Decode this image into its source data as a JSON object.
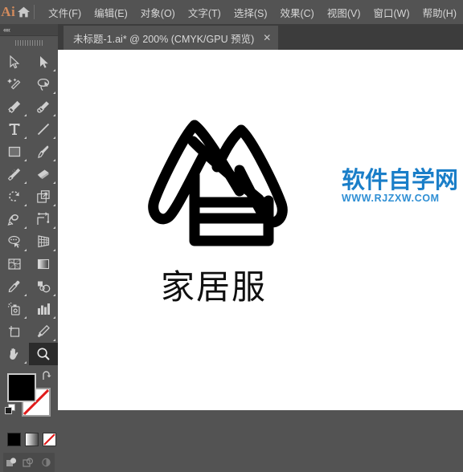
{
  "app": {
    "name": "Adobe Illustrator",
    "logo_text": "Ai",
    "logo_color": "#d38b5d",
    "chrome_bg": "#535353"
  },
  "menubar": {
    "home_icon": "home-icon",
    "items": [
      {
        "label": "文件(F)"
      },
      {
        "label": "编辑(E)"
      },
      {
        "label": "对象(O)"
      },
      {
        "label": "文字(T)"
      },
      {
        "label": "选择(S)"
      },
      {
        "label": "效果(C)"
      },
      {
        "label": "视图(V)"
      },
      {
        "label": "窗口(W)"
      },
      {
        "label": "帮助(H)"
      }
    ]
  },
  "tabbar": {
    "active_tab": "未标题-1.ai* @ 200% (CMYK/GPU 预览)",
    "close_label": "✕"
  },
  "toolbar": {
    "collapse_label": "««",
    "tools": [
      {
        "name": "selection-tool",
        "title": "选择工具",
        "has_flyout": false,
        "active": false
      },
      {
        "name": "direct-selection-tool",
        "title": "直接选择工具",
        "has_flyout": true,
        "active": false
      },
      {
        "name": "magic-wand-tool",
        "title": "魔棒工具",
        "has_flyout": false,
        "active": false
      },
      {
        "name": "lasso-tool",
        "title": "套索工具",
        "has_flyout": true,
        "active": false
      },
      {
        "name": "pen-tool",
        "title": "钢笔工具",
        "has_flyout": true,
        "active": false
      },
      {
        "name": "curvature-tool",
        "title": "曲率工具",
        "has_flyout": true,
        "active": false
      },
      {
        "name": "type-tool",
        "title": "文字工具",
        "has_flyout": true,
        "active": false
      },
      {
        "name": "line-segment-tool",
        "title": "直线段工具",
        "has_flyout": true,
        "active": false
      },
      {
        "name": "rectangle-tool",
        "title": "矩形工具",
        "has_flyout": true,
        "active": false
      },
      {
        "name": "paintbrush-tool",
        "title": "画笔工具",
        "has_flyout": true,
        "active": false
      },
      {
        "name": "shaper-tool",
        "title": "Shaper 工具",
        "has_flyout": true,
        "active": false
      },
      {
        "name": "eraser-tool",
        "title": "橡皮擦工具",
        "has_flyout": true,
        "active": false
      },
      {
        "name": "rotate-tool",
        "title": "旋转工具",
        "has_flyout": true,
        "active": false
      },
      {
        "name": "scale-tool",
        "title": "比例缩放工具",
        "has_flyout": true,
        "active": false
      },
      {
        "name": "width-tool",
        "title": "宽度工具",
        "has_flyout": true,
        "active": false
      },
      {
        "name": "free-transform-tool",
        "title": "自由变换工具",
        "has_flyout": true,
        "active": false
      },
      {
        "name": "shape-builder-tool",
        "title": "形状生成器工具",
        "has_flyout": true,
        "active": false
      },
      {
        "name": "perspective-grid-tool",
        "title": "透视网格工具",
        "has_flyout": true,
        "active": false
      },
      {
        "name": "mesh-tool",
        "title": "网格工具",
        "has_flyout": false,
        "active": false
      },
      {
        "name": "gradient-tool",
        "title": "渐变工具",
        "has_flyout": false,
        "active": false
      },
      {
        "name": "eyedropper-tool",
        "title": "吸管工具",
        "has_flyout": true,
        "active": false
      },
      {
        "name": "blend-tool",
        "title": "混合工具",
        "has_flyout": true,
        "active": false
      },
      {
        "name": "symbol-sprayer-tool",
        "title": "符号喷枪工具",
        "has_flyout": true,
        "active": false
      },
      {
        "name": "column-graph-tool",
        "title": "柱形图工具",
        "has_flyout": true,
        "active": false
      },
      {
        "name": "artboard-tool",
        "title": "画板工具",
        "has_flyout": false,
        "active": false
      },
      {
        "name": "slice-tool",
        "title": "切片工具",
        "has_flyout": true,
        "active": false
      },
      {
        "name": "hand-tool",
        "title": "抓手工具",
        "has_flyout": true,
        "active": false
      },
      {
        "name": "zoom-tool",
        "title": "缩放工具",
        "has_flyout": false,
        "active": true
      }
    ],
    "color": {
      "fill": "#000000",
      "stroke": "none",
      "swap_icon": "swap-arrow-icon",
      "default_icon": "default-colors-icon"
    },
    "swatches": [
      {
        "name": "color-swatch",
        "type": "solid"
      },
      {
        "name": "gradient-swatch",
        "type": "gradient"
      },
      {
        "name": "none-swatch",
        "type": "none"
      }
    ],
    "draw_modes": [
      {
        "name": "draw-normal-mode"
      },
      {
        "name": "draw-behind-mode"
      },
      {
        "name": "draw-inside-mode"
      }
    ]
  },
  "canvas": {
    "background": "#ffffff",
    "artwork_name": "homewear-house-logo",
    "label_text": "家居服"
  },
  "watermark": {
    "brand_cn": "软件自学网",
    "url": "WWW.RJZXW.COM",
    "color_cn": "#1a7ec8",
    "color_url": "#2f8fd4"
  }
}
